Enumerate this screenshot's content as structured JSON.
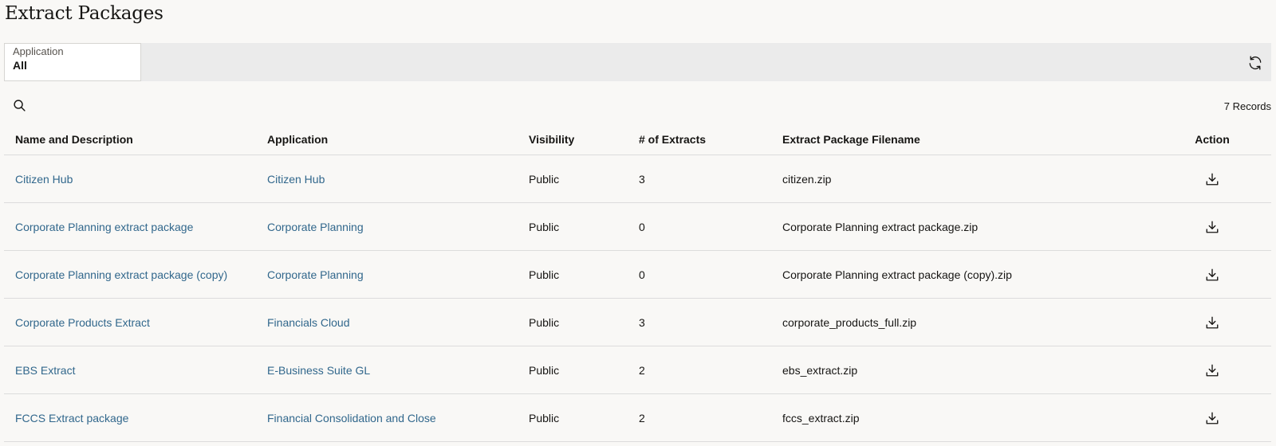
{
  "page": {
    "title": "Extract Packages"
  },
  "filter": {
    "label": "Application",
    "value": "All"
  },
  "icons": {
    "refresh": "refresh-icon",
    "search": "search-icon",
    "download": "download-icon"
  },
  "records": "7 Records",
  "table": {
    "headers": {
      "name": "Name and Description",
      "application": "Application",
      "visibility": "Visibility",
      "extracts": "# of Extracts",
      "filename": "Extract Package Filename",
      "action": "Action"
    },
    "rows": [
      {
        "name": "Citizen Hub",
        "application": "Citizen Hub",
        "visibility": "Public",
        "extracts": "3",
        "filename": "citizen.zip"
      },
      {
        "name": "Corporate Planning extract package",
        "application": "Corporate Planning",
        "visibility": "Public",
        "extracts": "0",
        "filename": "Corporate Planning extract package.zip"
      },
      {
        "name": "Corporate Planning extract package (copy)",
        "application": "Corporate Planning",
        "visibility": "Public",
        "extracts": "0",
        "filename": "Corporate Planning extract package (copy).zip"
      },
      {
        "name": "Corporate Products Extract",
        "application": "Financials Cloud",
        "visibility": "Public",
        "extracts": "3",
        "filename": "corporate_products_full.zip"
      },
      {
        "name": "EBS Extract",
        "application": "E-Business Suite GL",
        "visibility": "Public",
        "extracts": "2",
        "filename": "ebs_extract.zip"
      },
      {
        "name": "FCCS Extract package",
        "application": "Financial Consolidation and Close",
        "visibility": "Public",
        "extracts": "2",
        "filename": "fccs_extract.zip"
      }
    ]
  },
  "colors": {
    "link": "#31678c",
    "background": "#f9f8f6",
    "filterBar": "#ebebeb"
  }
}
